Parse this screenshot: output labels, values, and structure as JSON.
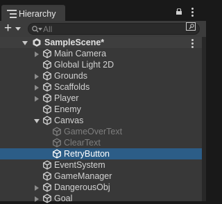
{
  "tab": {
    "title": "Hierarchy"
  },
  "search": {
    "placeholder": "All"
  },
  "scene": {
    "name": "SampleScene*"
  },
  "items": [
    {
      "label": "Main Camera",
      "expander": "collapsed",
      "state": "normal"
    },
    {
      "label": "Global Light 2D",
      "expander": "none",
      "state": "normal"
    },
    {
      "label": "Grounds",
      "expander": "collapsed",
      "state": "normal"
    },
    {
      "label": "Scaffolds",
      "expander": "collapsed",
      "state": "normal"
    },
    {
      "label": "Player",
      "expander": "collapsed",
      "state": "normal"
    },
    {
      "label": "Enemy",
      "expander": "none",
      "state": "normal"
    },
    {
      "label": "Canvas",
      "expander": "expanded",
      "state": "normal"
    },
    {
      "label": "GameOverText",
      "expander": "none",
      "state": "inactive"
    },
    {
      "label": "ClearText",
      "expander": "none",
      "state": "inactive"
    },
    {
      "label": "RetryButton",
      "expander": "none",
      "state": "selected"
    },
    {
      "label": "EventSystem",
      "expander": "none",
      "state": "normal"
    },
    {
      "label": "GameManager",
      "expander": "none",
      "state": "normal"
    },
    {
      "label": "DangerousObj",
      "expander": "collapsed",
      "state": "normal"
    },
    {
      "label": "Goal",
      "expander": "collapsed",
      "state": "normal"
    }
  ],
  "icons": {
    "tab": "hierarchy-icon",
    "lock": "lock-icon",
    "menu": "kebab-menu-icon",
    "add": "plus-icon",
    "search": "search-icon",
    "search_options": "search-by-type-icon",
    "scene": "unity-scene-icon",
    "gameobject": "cube-icon"
  },
  "colors": {
    "selection": "#2c5d87",
    "panel": "#383838",
    "inactive_text": "#7e7e7e"
  }
}
